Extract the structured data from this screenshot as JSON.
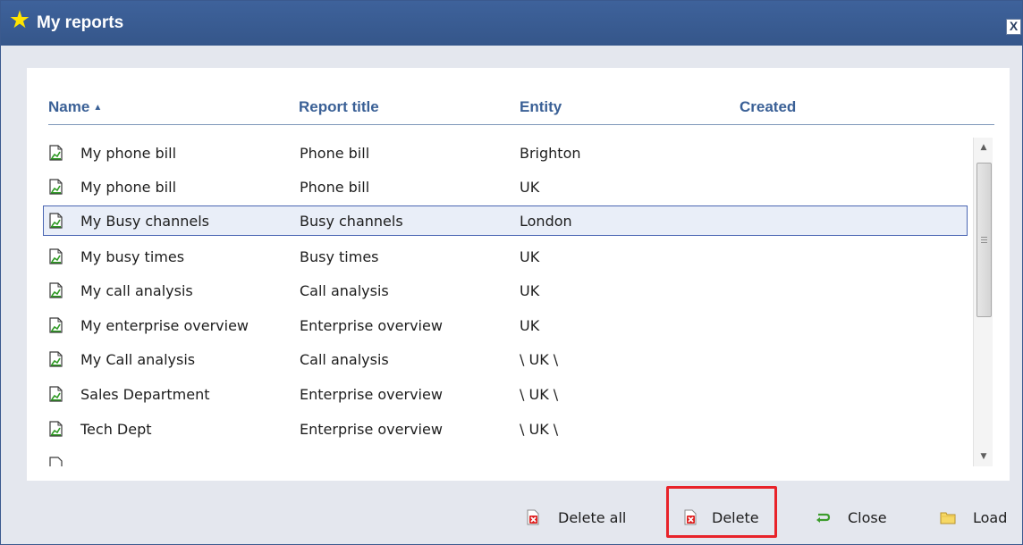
{
  "window": {
    "title": "My reports",
    "close_label": "X"
  },
  "table": {
    "headers": {
      "name": "Name",
      "sort_indicator": "▲",
      "report_title": "Report title",
      "entity": "Entity",
      "created": "Created"
    },
    "rows": [
      {
        "name": "My phone bill",
        "report_title": "Phone bill",
        "entity": "Brighton",
        "created": ""
      },
      {
        "name": "My phone bill",
        "report_title": "Phone bill",
        "entity": "UK",
        "created": ""
      },
      {
        "name": "My Busy channels",
        "report_title": "Busy channels",
        "entity": "London",
        "created": "",
        "selected": true
      },
      {
        "name": "My busy times",
        "report_title": "Busy times",
        "entity": "UK",
        "created": ""
      },
      {
        "name": "My call analysis",
        "report_title": "Call analysis",
        "entity": "UK",
        "created": ""
      },
      {
        "name": "My enterprise overview",
        "report_title": "Enterprise overview",
        "entity": "UK",
        "created": ""
      },
      {
        "name": "My Call analysis",
        "report_title": "Call analysis",
        "entity": "\\ UK \\",
        "created": ""
      },
      {
        "name": "Sales Department",
        "report_title": "Enterprise overview",
        "entity": "\\ UK \\",
        "created": ""
      },
      {
        "name": "Tech Dept",
        "report_title": "Enterprise overview",
        "entity": "\\ UK \\",
        "created": ""
      }
    ]
  },
  "footer": {
    "delete_all_label": "Delete all",
    "delete_label": "Delete",
    "close_label": "Close",
    "load_label": "Load"
  },
  "colors": {
    "titlebar": "#3a5d96",
    "header_text": "#3a6096",
    "selection_border": "#4a66b3",
    "highlight_box": "#e8232a"
  }
}
